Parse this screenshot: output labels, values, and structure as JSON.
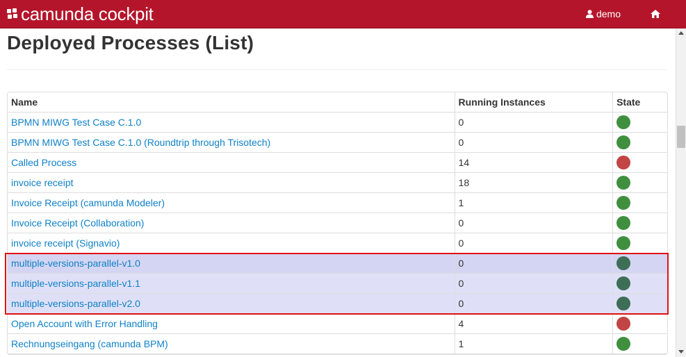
{
  "header": {
    "brand_text": "camunda cockpit",
    "user_label": "demo",
    "home_icon": "home-icon",
    "user_icon": "user-icon"
  },
  "page": {
    "title": "Deployed Processes (List)"
  },
  "table": {
    "headers": [
      "Name",
      "Running Instances",
      "State"
    ],
    "rows": [
      {
        "name": "BPMN MIWG Test Case C.1.0",
        "instances": "0",
        "state": "ok"
      },
      {
        "name": "BPMN MIWG Test Case C.1.0 (Roundtrip through Trisotech)",
        "instances": "0",
        "state": "ok"
      },
      {
        "name": "Called Process",
        "instances": "14",
        "state": "error"
      },
      {
        "name": "invoice receipt",
        "instances": "18",
        "state": "ok"
      },
      {
        "name": "Invoice Receipt (camunda Modeler)",
        "instances": "1",
        "state": "ok"
      },
      {
        "name": "Invoice Receipt (Collaboration)",
        "instances": "0",
        "state": "ok"
      },
      {
        "name": "invoice receipt (Signavio)",
        "instances": "0",
        "state": "ok"
      },
      {
        "name": "multiple-versions-parallel-v1.0",
        "instances": "0",
        "state": "ok"
      },
      {
        "name": "multiple-versions-parallel-v1.1",
        "instances": "0",
        "state": "ok"
      },
      {
        "name": "multiple-versions-parallel-v2.0",
        "instances": "0",
        "state": "ok"
      },
      {
        "name": "Open Account with Error Handling",
        "instances": "4",
        "state": "error"
      },
      {
        "name": "Rechnungseingang (camunda BPM)",
        "instances": "1",
        "state": "ok"
      }
    ]
  },
  "colors": {
    "brand": "#b5152b",
    "link": "#0f81c7",
    "state_ok": "#3f8f3f",
    "state_ok_highlighted": "#3e6e56",
    "state_error": "#c24444",
    "highlight_box": "#e01010"
  }
}
